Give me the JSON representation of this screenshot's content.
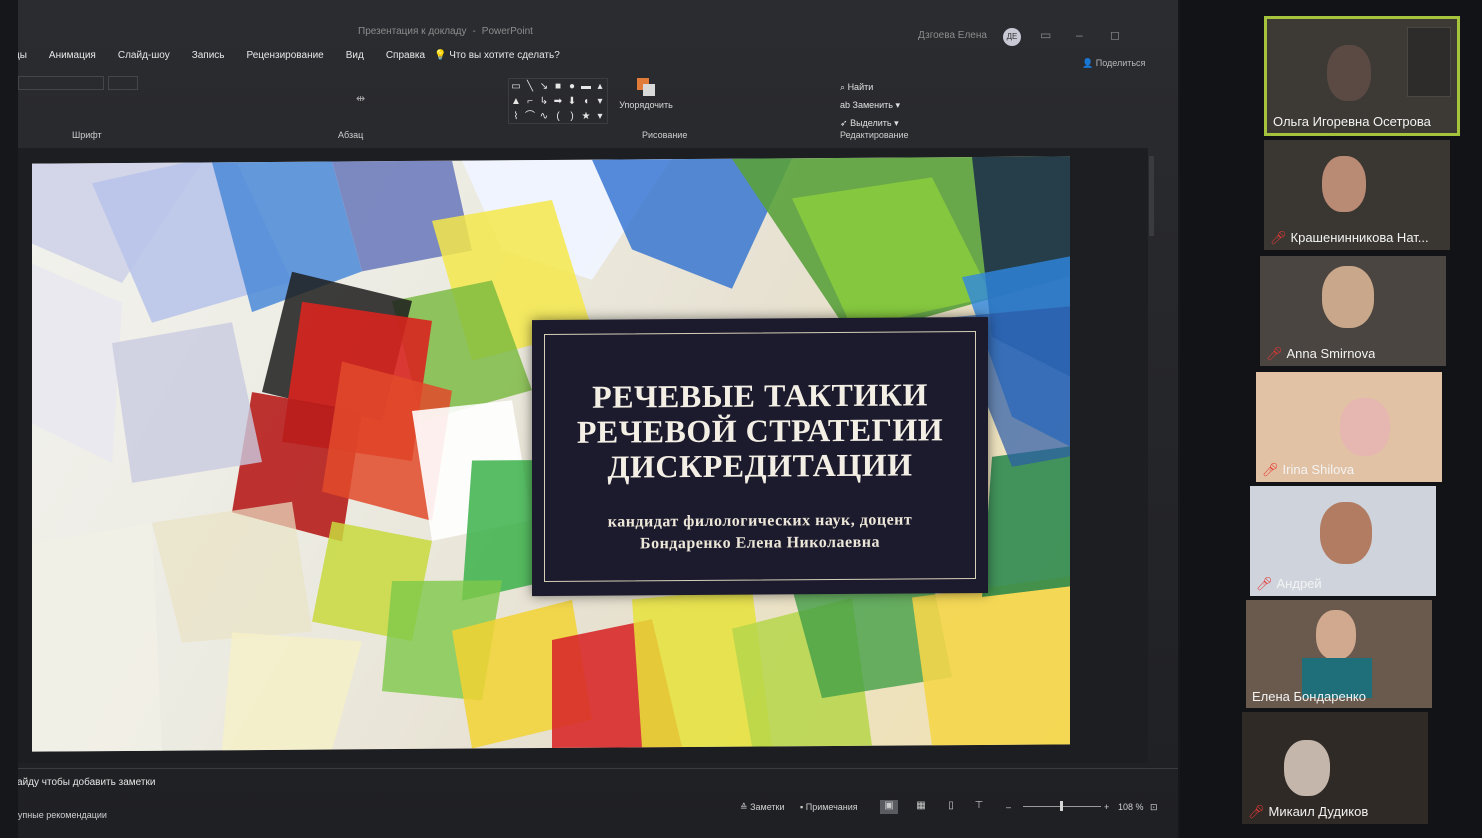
{
  "window": {
    "title": "Презентация к докладу",
    "app": "PowerPoint",
    "user": "Дзгоева Елена",
    "user_initials": "ДЕ",
    "share_label": "Поделиться"
  },
  "menu": {
    "items": [
      "Переходы",
      "Анимация",
      "Слайд-шоу",
      "Запись",
      "Рецензирование",
      "Вид",
      "Справка"
    ],
    "tell_me": "Что вы хотите сделать?"
  },
  "ribbon": {
    "groups": {
      "font": "Шрифт",
      "paragraph": "Абзац",
      "drawing": "Рисование",
      "editing": "Редактирование"
    },
    "arrange_label": "Упорядочить",
    "find_label": "Найти",
    "replace_label": "Заменить",
    "select_label": "Выделить"
  },
  "slide": {
    "title_lines": [
      "РЕЧЕВЫЕ ТАКТИКИ",
      "РЕЧЕВОЙ СТРАТЕГИИ",
      "ДИСКРЕДИТАЦИИ"
    ],
    "subtitle_lines": [
      "кандидат филологических наук, доцент",
      "Бондаренко Елена Николаевна"
    ]
  },
  "notes_placeholder": "Заметки к слайду чтобы добавить заметки",
  "status": {
    "left": "Доступные рекомендации",
    "notes_label": "Заметки",
    "comments_label": "Примечания",
    "zoom": "108 %"
  },
  "participants": [
    {
      "name": "Ольга Игоревна Осетрова",
      "muted": false,
      "active": true
    },
    {
      "name": "Крашенинникова Нат...",
      "muted": true,
      "active": false
    },
    {
      "name": "Anna Smirnova",
      "muted": true,
      "active": false
    },
    {
      "name": "Irina Shilova",
      "muted": true,
      "active": false
    },
    {
      "name": "Андрей",
      "muted": true,
      "active": false
    },
    {
      "name": "Елена Бондаренко",
      "muted": false,
      "active": false
    },
    {
      "name": "Микаил Дудиков",
      "muted": true,
      "active": false
    }
  ],
  "icons": {
    "mic_muted": "mic-muted-icon",
    "tell_me": "lightbulb-icon",
    "share": "person-icon"
  }
}
